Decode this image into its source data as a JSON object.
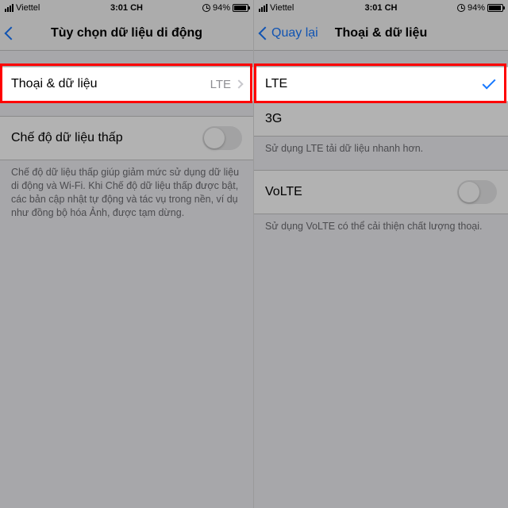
{
  "status": {
    "carrier": "Viettel",
    "time": "3:01 CH",
    "battery_pct": "94%"
  },
  "left_screen": {
    "nav_title": "Tùy chọn dữ liệu di động",
    "row_voice_data": {
      "label": "Thoại & dữ liệu",
      "value": "LTE"
    },
    "row_low_data": {
      "label": "Chế độ dữ liệu thấp"
    },
    "low_data_footer": "Chế độ dữ liệu thấp giúp giảm mức sử dụng dữ liệu di động và Wi-Fi. Khi Chế độ dữ liệu thấp được bật, các bản cập nhật tự động và tác vụ trong nền, ví dụ như đồng bộ hóa Ảnh, được tạm dừng."
  },
  "right_screen": {
    "back_label": "Quay lại",
    "nav_title": "Thoại & dữ liệu",
    "row_lte": "LTE",
    "row_3g": "3G",
    "footer_lte": "Sử dụng LTE tải dữ liệu nhanh hơn.",
    "row_volte": "VoLTE",
    "footer_volte": "Sử dụng VoLTE có thể cải thiện chất lượng thoại."
  }
}
